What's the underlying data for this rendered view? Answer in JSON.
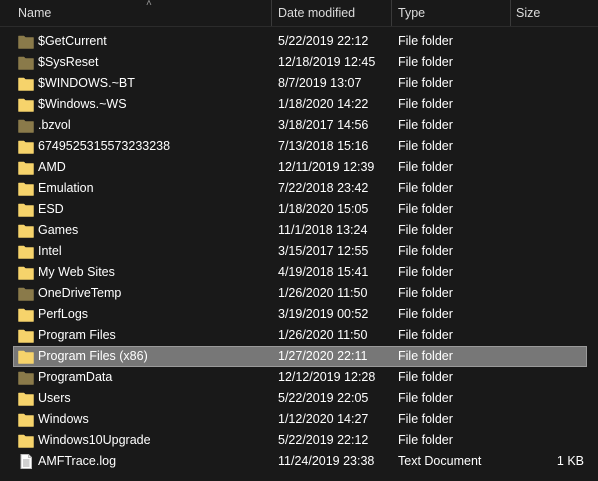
{
  "columns": {
    "name": "Name",
    "date_modified": "Date modified",
    "type": "Type",
    "size": "Size"
  },
  "colors": {
    "folder": "#f6d36b",
    "folder_hidden": "#8a7a4a",
    "selection": "#777777"
  },
  "rows": [
    {
      "name": "$GetCurrent",
      "date": "5/22/2019 22:12",
      "type": "File folder",
      "size": "",
      "icon": "folder-hidden-icon"
    },
    {
      "name": "$SysReset",
      "date": "12/18/2019 12:45",
      "type": "File folder",
      "size": "",
      "icon": "folder-hidden-icon"
    },
    {
      "name": "$WINDOWS.~BT",
      "date": "8/7/2019 13:07",
      "type": "File folder",
      "size": "",
      "icon": "folder-icon"
    },
    {
      "name": "$Windows.~WS",
      "date": "1/18/2020 14:22",
      "type": "File folder",
      "size": "",
      "icon": "folder-icon"
    },
    {
      "name": ".bzvol",
      "date": "3/18/2017 14:56",
      "type": "File folder",
      "size": "",
      "icon": "folder-hidden-icon"
    },
    {
      "name": "6749525315573233238",
      "date": "7/13/2018 15:16",
      "type": "File folder",
      "size": "",
      "icon": "folder-icon"
    },
    {
      "name": "AMD",
      "date": "12/11/2019 12:39",
      "type": "File folder",
      "size": "",
      "icon": "folder-icon"
    },
    {
      "name": "Emulation",
      "date": "7/22/2018 23:42",
      "type": "File folder",
      "size": "",
      "icon": "folder-icon"
    },
    {
      "name": "ESD",
      "date": "1/18/2020 15:05",
      "type": "File folder",
      "size": "",
      "icon": "folder-icon"
    },
    {
      "name": "Games",
      "date": "11/1/2018 13:24",
      "type": "File folder",
      "size": "",
      "icon": "folder-icon"
    },
    {
      "name": "Intel",
      "date": "3/15/2017 12:55",
      "type": "File folder",
      "size": "",
      "icon": "folder-icon"
    },
    {
      "name": "My Web Sites",
      "date": "4/19/2018 15:41",
      "type": "File folder",
      "size": "",
      "icon": "folder-icon"
    },
    {
      "name": "OneDriveTemp",
      "date": "1/26/2020 11:50",
      "type": "File folder",
      "size": "",
      "icon": "folder-hidden-icon"
    },
    {
      "name": "PerfLogs",
      "date": "3/19/2019 00:52",
      "type": "File folder",
      "size": "",
      "icon": "folder-icon"
    },
    {
      "name": "Program Files",
      "date": "1/26/2020 11:50",
      "type": "File folder",
      "size": "",
      "icon": "folder-icon"
    },
    {
      "name": "Program Files (x86)",
      "date": "1/27/2020 22:11",
      "type": "File folder",
      "size": "",
      "icon": "folder-icon",
      "selected": true
    },
    {
      "name": "ProgramData",
      "date": "12/12/2019 12:28",
      "type": "File folder",
      "size": "",
      "icon": "folder-hidden-icon"
    },
    {
      "name": "Users",
      "date": "5/22/2019 22:05",
      "type": "File folder",
      "size": "",
      "icon": "folder-icon"
    },
    {
      "name": "Windows",
      "date": "1/12/2020 14:27",
      "type": "File folder",
      "size": "",
      "icon": "folder-icon"
    },
    {
      "name": "Windows10Upgrade",
      "date": "5/22/2019 22:12",
      "type": "File folder",
      "size": "",
      "icon": "folder-icon"
    },
    {
      "name": "AMFTrace.log",
      "date": "11/24/2019 23:38",
      "type": "Text Document",
      "size": "1 KB",
      "icon": "text-document-icon"
    }
  ]
}
